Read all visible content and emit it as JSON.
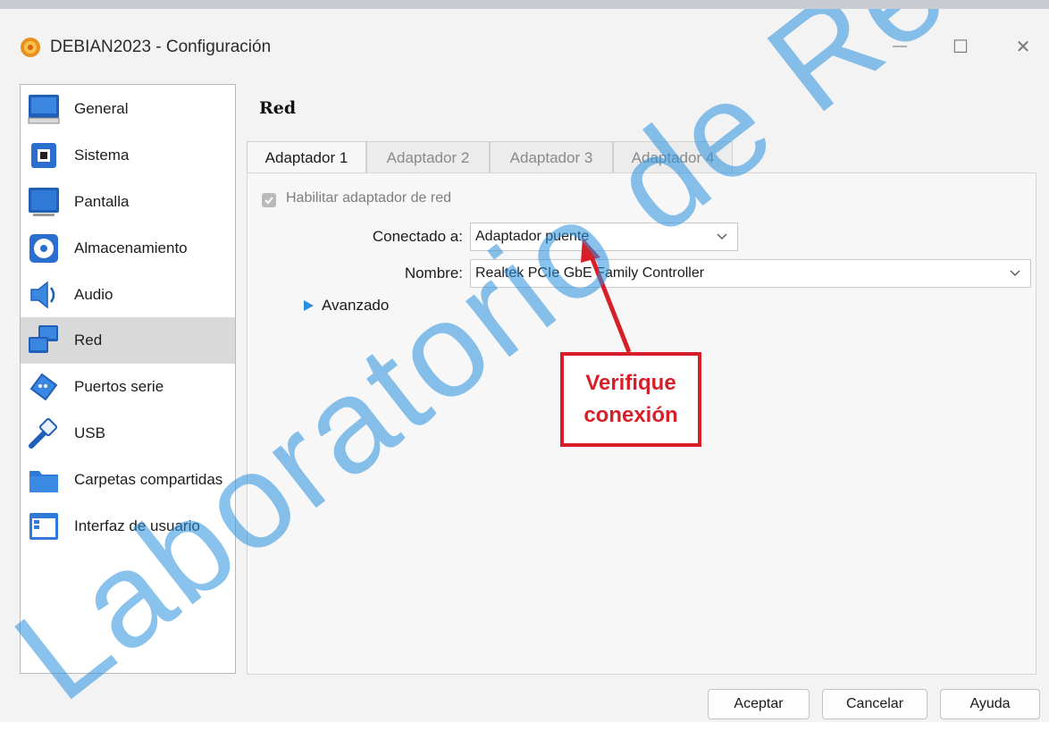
{
  "window": {
    "title": "DEBIAN2023 - Configuración",
    "controls": {
      "minimize": "—",
      "maximize": "☐",
      "close": "✕"
    }
  },
  "sidebar": {
    "items": [
      {
        "label": "General",
        "icon": "monitor-icon"
      },
      {
        "label": "Sistema",
        "icon": "chip-icon"
      },
      {
        "label": "Pantalla",
        "icon": "display-icon"
      },
      {
        "label": "Almacenamiento",
        "icon": "disk-icon"
      },
      {
        "label": "Audio",
        "icon": "speaker-icon"
      },
      {
        "label": "Red",
        "icon": "network-icon",
        "selected": true
      },
      {
        "label": "Puertos serie",
        "icon": "serial-port-icon"
      },
      {
        "label": "USB",
        "icon": "usb-icon"
      },
      {
        "label": "Carpetas compartidas",
        "icon": "folder-icon"
      },
      {
        "label": "Interfaz de usuario",
        "icon": "ui-window-icon"
      }
    ]
  },
  "main": {
    "section_title": "Red",
    "tabs": [
      {
        "label": "Adaptador 1",
        "active": true
      },
      {
        "label": "Adaptador 2"
      },
      {
        "label": "Adaptador 3"
      },
      {
        "label": "Adaptador 4"
      }
    ],
    "enable_adapter": {
      "label": "Habilitar adaptador de red",
      "checked": true
    },
    "connected_to": {
      "label": "Conectado a:",
      "value": "Adaptador puente"
    },
    "name": {
      "label": "Nombre:",
      "value": "Realtek PCIe GbE Family Controller"
    },
    "advanced": {
      "label": "Avanzado"
    }
  },
  "annotation": {
    "line1": "Verifique",
    "line2": "conexión",
    "color": "#d81e28"
  },
  "footer": {
    "accept": "Aceptar",
    "cancel": "Cancelar",
    "help": "Ayuda"
  },
  "watermark": {
    "text": "Laboratorio de Redes Y Se",
    "color": "#2a8fe0"
  }
}
